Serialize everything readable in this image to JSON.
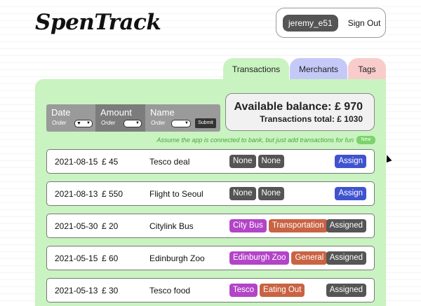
{
  "app": {
    "title": "SpenTrack",
    "username": "jeremy_e51",
    "sign_out": "Sign Out"
  },
  "tabs": [
    {
      "label": "Transactions",
      "color": "#c9f3c0",
      "active": true
    },
    {
      "label": "Merchants",
      "color": "#c5c9f7",
      "active": false
    },
    {
      "label": "Tags",
      "color": "#f9cccc",
      "active": false
    }
  ],
  "sort": {
    "columns": [
      {
        "label": "Date",
        "order_label": "Order",
        "selected": "▼"
      },
      {
        "label": "Amount",
        "order_label": "Order",
        "selected": ""
      },
      {
        "label": "Name",
        "order_label": "Order",
        "selected": ""
      }
    ],
    "submit_label": "Submit"
  },
  "balance": {
    "available": "Available balance: £ 970",
    "total": "Transactions total: £ 1030"
  },
  "hint": "Assume the app is connected to bank, but just add transactions for fun",
  "new_label": "New",
  "transactions": [
    {
      "date": "2021-08-15",
      "amount": "£ 45",
      "desc": "Tesco deal",
      "tags": [
        "None",
        "None"
      ],
      "tag_colors": [
        "gray",
        "gray"
      ],
      "action": "Assign"
    },
    {
      "date": "2021-08-13",
      "amount": "£ 550",
      "desc": "Flight to Seoul",
      "tags": [
        "None",
        "None"
      ],
      "tag_colors": [
        "gray",
        "gray"
      ],
      "action": "Assign"
    },
    {
      "date": "2021-05-30",
      "amount": "£ 20",
      "desc": "Citylink Bus",
      "tags": [
        "City Bus",
        "Transportation"
      ],
      "tag_colors": [
        "purple",
        "orange"
      ],
      "action": "Assigned"
    },
    {
      "date": "2021-05-15",
      "amount": "£ 60",
      "desc": "Edinburgh Zoo",
      "tags": [
        "Edinburgh Zoo",
        "General"
      ],
      "tag_colors": [
        "purple",
        "orange"
      ],
      "action": "Assigned"
    },
    {
      "date": "2021-05-13",
      "amount": "£ 30",
      "desc": "Tesco food",
      "tags": [
        "Tesco",
        "Eating Out"
      ],
      "tag_colors": [
        "purple",
        "orange"
      ],
      "action": "Assigned"
    }
  ],
  "colors": {
    "panel": "#c9f3c0",
    "assign": "#3f53cf",
    "assigned": "#555555",
    "tag_purple": "#b344c7",
    "tag_orange": "#c96343"
  }
}
